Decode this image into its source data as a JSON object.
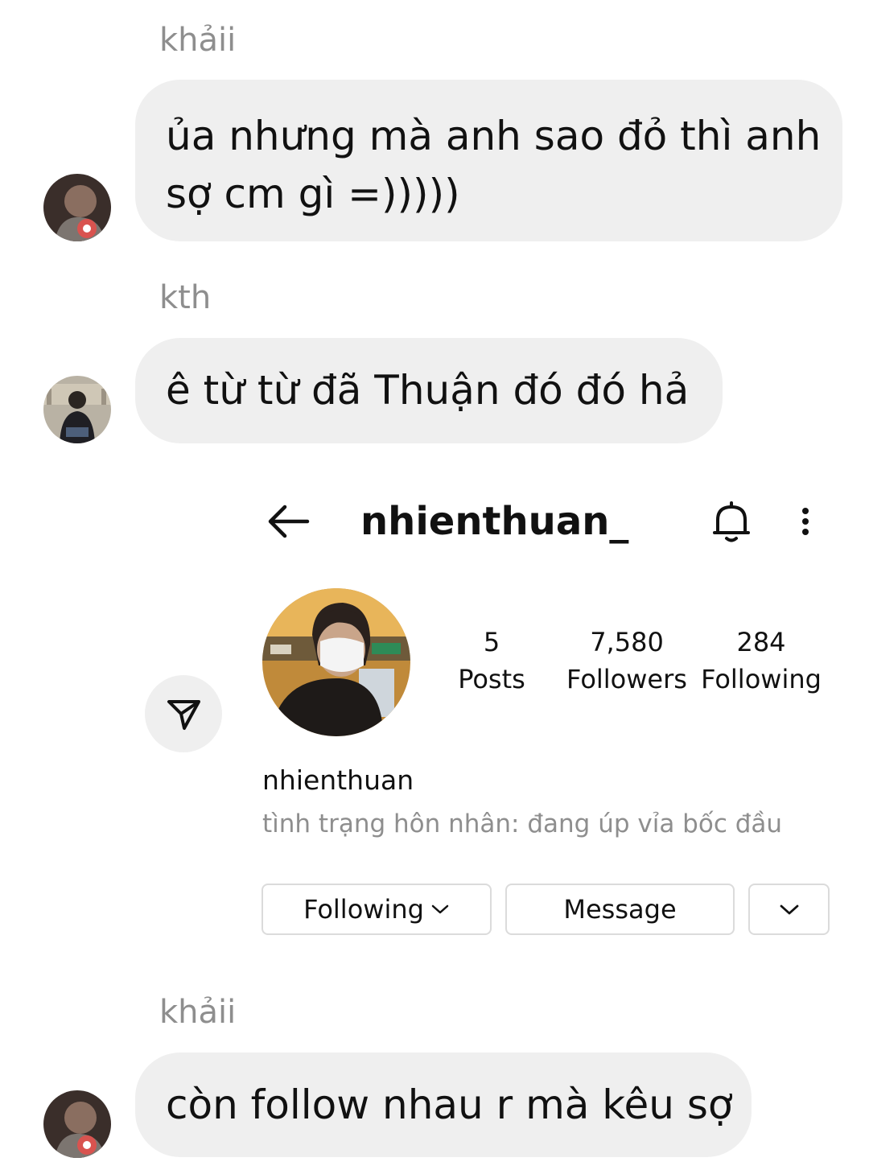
{
  "messages": [
    {
      "sender": "khảii",
      "lines": [
        "ủa nhưng mà anh sao đỏ thì anh",
        "sợ cm gì =)))))"
      ]
    },
    {
      "sender": "kth",
      "lines": [
        "ê từ từ đã Thuận đó đó hả"
      ]
    },
    {
      "sender": "khảii",
      "lines": [
        "còn follow nhau r mà kêu sợ"
      ]
    }
  ],
  "profile_card": {
    "username": "nhienthuan_",
    "stats": [
      {
        "value": "5",
        "label": "Posts"
      },
      {
        "value": "7,580",
        "label": "Followers"
      },
      {
        "value": "284",
        "label": "Following"
      }
    ],
    "display_name": "nhienthuan",
    "bio": "tình trạng hôn nhân: đang úp vỉa bốc đầu",
    "buttons": {
      "following": "Following",
      "message": "Message"
    },
    "icons": {
      "back": "arrow-left-icon",
      "bell": "bell-icon",
      "more": "more-vertical-icon",
      "share": "send-icon",
      "dropdown": "chevron-down-icon"
    }
  },
  "colors": {
    "bubble": "#efefef",
    "sender_name": "#8e8e8e",
    "bio": "#8e8e8e",
    "button_border": "#dbdbdb"
  }
}
